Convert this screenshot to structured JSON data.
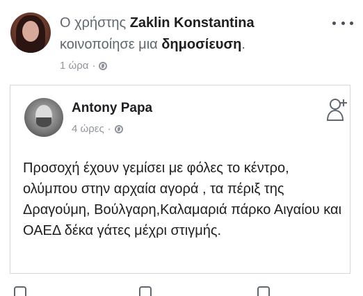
{
  "share": {
    "prefix": "Ο χρήστης",
    "sharer_name": "Zaklin Konstantina",
    "action_text": "κοινοποίησε μια",
    "object_text": "δημοσίευση",
    "period": ".",
    "time": "1 ώρα",
    "separator": "·"
  },
  "post": {
    "author_name": "Antony Papa",
    "time": "4 ώρες",
    "separator": "·",
    "text": "Προσοχή έχουν γεμίσει με φόλες το κέντρο, ολύμπου στην αρχαία αγορά , τα πέριξ της Δραγούμη, Βούλγαρη,Καλαμαριά πάρκο Αιγαίου και ΟΑΕΔ δέκα γάτες μέχρι στιγμής."
  },
  "icons": {
    "more": "more-horizontal-icon",
    "privacy": "globe-icon",
    "add_friend": "add-friend-icon"
  }
}
